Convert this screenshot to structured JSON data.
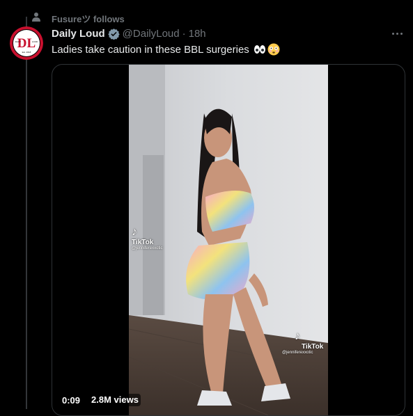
{
  "social_context": {
    "text": "Fusureツ follows"
  },
  "tweet": {
    "author_name": "Daily Loud",
    "handle": "@DailyLoud",
    "separator": "·",
    "timestamp": "18h",
    "text": "Ladies take caution in these BBL surgeries",
    "emojis": [
      "eyes-emoji",
      "flushed-face-emoji"
    ]
  },
  "avatar": {
    "logo_text": "DL",
    "sub_left": "DAILY",
    "sub_right": "LOUD",
    "est": "Est. 2018"
  },
  "media": {
    "duration": "0:09",
    "views": "2.8M views",
    "watermark_top": {
      "brand": "TikTok",
      "user": "@jenniferexxotic"
    },
    "watermark_bottom": {
      "brand": "TikTok",
      "user": "@jenniferexxotic"
    }
  },
  "colors": {
    "background": "#000000",
    "text": "#e7e9ea",
    "secondary": "#71767b",
    "border": "#2f3336",
    "verified": "#829aab"
  }
}
